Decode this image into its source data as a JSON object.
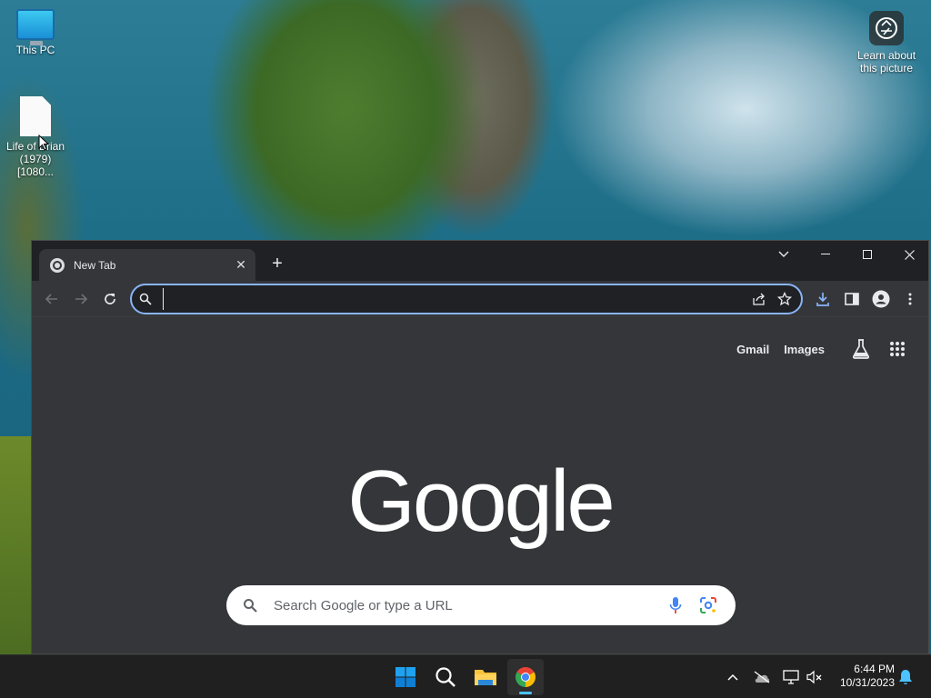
{
  "desktop": {
    "icons": [
      {
        "label": "This PC"
      },
      {
        "label": "Life of Brian (1979) [1080..."
      },
      {
        "label": "Learn about this picture"
      }
    ]
  },
  "browser": {
    "tab": {
      "title": "New Tab"
    },
    "omnibox": {
      "value": "",
      "placeholder": ""
    },
    "accent_color": "#8ab4f8"
  },
  "ntp": {
    "links": {
      "gmail": "Gmail",
      "images": "Images"
    },
    "logo_text": "Google",
    "search_placeholder": "Search Google or type a URL"
  },
  "taskbar": {
    "apps": [
      "start-icon",
      "search-icon",
      "file-explorer-icon",
      "chrome-icon"
    ],
    "clock": {
      "time": "6:44 PM",
      "date": "10/31/2023"
    }
  }
}
